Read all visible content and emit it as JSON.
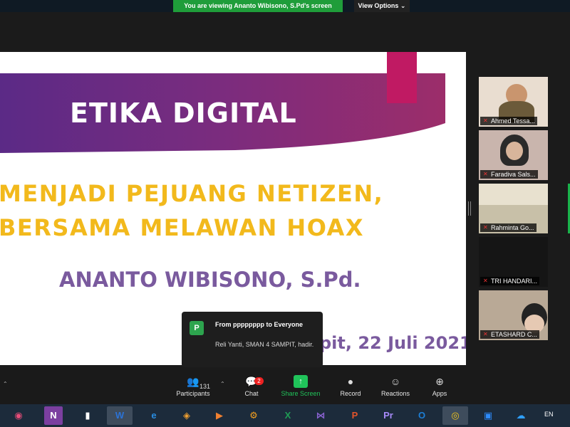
{
  "meeting": {
    "banner": "You are viewing Ananto Wibisono, S.Pd's screen",
    "view_options": "View Options"
  },
  "slide": {
    "title": "ETIKA DIGITAL",
    "subtitle_line1": "MENJADI PEJUANG NETIZEN,",
    "subtitle_line2": "BERSAMA MELAWAN HOAX",
    "author": "ANANTO WIBISONO, S.Pd.",
    "date": "pit, 22 Juli 2021"
  },
  "chat_notification": {
    "avatar_letter": "P",
    "from": "From pppppppp to Everyone",
    "message": "Reli Yanti, SMAN 4 SAMPIT, hadir."
  },
  "participants": [
    {
      "name": "Ahmed Tessa..."
    },
    {
      "name": "Faradiva Sals..."
    },
    {
      "name": "Rahminta Go..."
    },
    {
      "name": "TRI HANDARI..."
    },
    {
      "name": "ETASHARD C..."
    }
  ],
  "toolbar": {
    "participants_label": "Participants",
    "participants_count": "131",
    "chat_label": "Chat",
    "chat_badge": "2",
    "share_label": "Share Screen",
    "record_label": "Record",
    "reactions_label": "Reactions",
    "apps_label": "Apps"
  },
  "taskbar": {
    "apps": [
      "teams",
      "onenote",
      "file",
      "word",
      "edge",
      "uc-browser",
      "media-player",
      "settings",
      "excel",
      "visual-studio",
      "powerpoint",
      "premiere",
      "outlook",
      "chrome",
      "zoom",
      "onedrive"
    ],
    "language": "EN"
  }
}
